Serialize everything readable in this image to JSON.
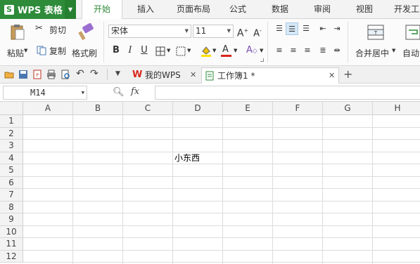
{
  "app": {
    "title": "WPS 表格",
    "logo": "S"
  },
  "tabs": [
    "开始",
    "插入",
    "页面布局",
    "公式",
    "数据",
    "审阅",
    "视图",
    "开发工"
  ],
  "active_tab": "开始",
  "ribbon": {
    "paste": "粘贴",
    "cut": "剪切",
    "copy": "复制",
    "format_painter": "格式刷",
    "font_name": "宋体",
    "font_size": "11",
    "merge_center": "合并居中",
    "auto_wrap": "自动"
  },
  "doc_tabs": [
    {
      "label": "我的WPS"
    },
    {
      "label": "工作簿1 *"
    }
  ],
  "formula_bar": {
    "cell_ref": "M14",
    "fx": "fx",
    "value": ""
  },
  "columns": [
    "A",
    "B",
    "C",
    "D",
    "E",
    "F",
    "G",
    "H"
  ],
  "rows": [
    "1",
    "2",
    "3",
    "4",
    "5",
    "6",
    "7",
    "8",
    "9",
    "10",
    "11",
    "12"
  ],
  "cells": {
    "D4": "小东西"
  },
  "colors": {
    "brand": "#2e8b3a",
    "accent_red": "#d9261c"
  }
}
